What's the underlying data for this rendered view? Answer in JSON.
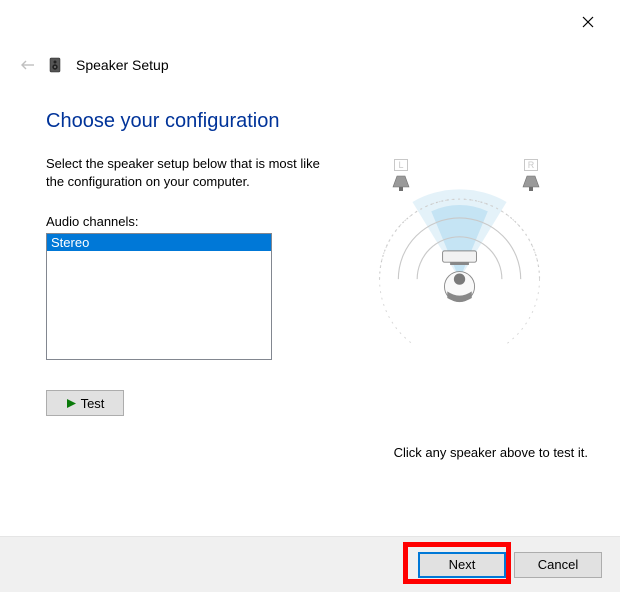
{
  "window": {
    "title": "Speaker Setup"
  },
  "content": {
    "heading": "Choose your configuration",
    "instruction_line1": "Select the speaker setup below that is most like",
    "instruction_line2": "the configuration on your computer.",
    "channels_label": "Audio channels:",
    "channels_items": [
      "Stereo"
    ],
    "test_label": "Test"
  },
  "diagram": {
    "left_label": "L",
    "right_label": "R",
    "hint": "Click any speaker above to test it."
  },
  "footer": {
    "next_label": "Next",
    "cancel_label": "Cancel"
  }
}
